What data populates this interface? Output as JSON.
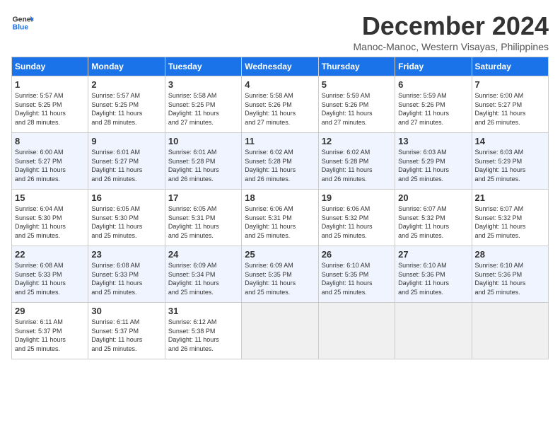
{
  "header": {
    "logo_line1": "General",
    "logo_line2": "Blue",
    "month_year": "December 2024",
    "location": "Manoc-Manoc, Western Visayas, Philippines"
  },
  "weekdays": [
    "Sunday",
    "Monday",
    "Tuesday",
    "Wednesday",
    "Thursday",
    "Friday",
    "Saturday"
  ],
  "weeks": [
    [
      {
        "day": "1",
        "info": "Sunrise: 5:57 AM\nSunset: 5:25 PM\nDaylight: 11 hours\nand 28 minutes."
      },
      {
        "day": "2",
        "info": "Sunrise: 5:57 AM\nSunset: 5:25 PM\nDaylight: 11 hours\nand 28 minutes."
      },
      {
        "day": "3",
        "info": "Sunrise: 5:58 AM\nSunset: 5:25 PM\nDaylight: 11 hours\nand 27 minutes."
      },
      {
        "day": "4",
        "info": "Sunrise: 5:58 AM\nSunset: 5:26 PM\nDaylight: 11 hours\nand 27 minutes."
      },
      {
        "day": "5",
        "info": "Sunrise: 5:59 AM\nSunset: 5:26 PM\nDaylight: 11 hours\nand 27 minutes."
      },
      {
        "day": "6",
        "info": "Sunrise: 5:59 AM\nSunset: 5:26 PM\nDaylight: 11 hours\nand 27 minutes."
      },
      {
        "day": "7",
        "info": "Sunrise: 6:00 AM\nSunset: 5:27 PM\nDaylight: 11 hours\nand 26 minutes."
      }
    ],
    [
      {
        "day": "8",
        "info": "Sunrise: 6:00 AM\nSunset: 5:27 PM\nDaylight: 11 hours\nand 26 minutes."
      },
      {
        "day": "9",
        "info": "Sunrise: 6:01 AM\nSunset: 5:27 PM\nDaylight: 11 hours\nand 26 minutes."
      },
      {
        "day": "10",
        "info": "Sunrise: 6:01 AM\nSunset: 5:28 PM\nDaylight: 11 hours\nand 26 minutes."
      },
      {
        "day": "11",
        "info": "Sunrise: 6:02 AM\nSunset: 5:28 PM\nDaylight: 11 hours\nand 26 minutes."
      },
      {
        "day": "12",
        "info": "Sunrise: 6:02 AM\nSunset: 5:28 PM\nDaylight: 11 hours\nand 26 minutes."
      },
      {
        "day": "13",
        "info": "Sunrise: 6:03 AM\nSunset: 5:29 PM\nDaylight: 11 hours\nand 25 minutes."
      },
      {
        "day": "14",
        "info": "Sunrise: 6:03 AM\nSunset: 5:29 PM\nDaylight: 11 hours\nand 25 minutes."
      }
    ],
    [
      {
        "day": "15",
        "info": "Sunrise: 6:04 AM\nSunset: 5:30 PM\nDaylight: 11 hours\nand 25 minutes."
      },
      {
        "day": "16",
        "info": "Sunrise: 6:05 AM\nSunset: 5:30 PM\nDaylight: 11 hours\nand 25 minutes."
      },
      {
        "day": "17",
        "info": "Sunrise: 6:05 AM\nSunset: 5:31 PM\nDaylight: 11 hours\nand 25 minutes."
      },
      {
        "day": "18",
        "info": "Sunrise: 6:06 AM\nSunset: 5:31 PM\nDaylight: 11 hours\nand 25 minutes."
      },
      {
        "day": "19",
        "info": "Sunrise: 6:06 AM\nSunset: 5:32 PM\nDaylight: 11 hours\nand 25 minutes."
      },
      {
        "day": "20",
        "info": "Sunrise: 6:07 AM\nSunset: 5:32 PM\nDaylight: 11 hours\nand 25 minutes."
      },
      {
        "day": "21",
        "info": "Sunrise: 6:07 AM\nSunset: 5:32 PM\nDaylight: 11 hours\nand 25 minutes."
      }
    ],
    [
      {
        "day": "22",
        "info": "Sunrise: 6:08 AM\nSunset: 5:33 PM\nDaylight: 11 hours\nand 25 minutes."
      },
      {
        "day": "23",
        "info": "Sunrise: 6:08 AM\nSunset: 5:33 PM\nDaylight: 11 hours\nand 25 minutes."
      },
      {
        "day": "24",
        "info": "Sunrise: 6:09 AM\nSunset: 5:34 PM\nDaylight: 11 hours\nand 25 minutes."
      },
      {
        "day": "25",
        "info": "Sunrise: 6:09 AM\nSunset: 5:35 PM\nDaylight: 11 hours\nand 25 minutes."
      },
      {
        "day": "26",
        "info": "Sunrise: 6:10 AM\nSunset: 5:35 PM\nDaylight: 11 hours\nand 25 minutes."
      },
      {
        "day": "27",
        "info": "Sunrise: 6:10 AM\nSunset: 5:36 PM\nDaylight: 11 hours\nand 25 minutes."
      },
      {
        "day": "28",
        "info": "Sunrise: 6:10 AM\nSunset: 5:36 PM\nDaylight: 11 hours\nand 25 minutes."
      }
    ],
    [
      {
        "day": "29",
        "info": "Sunrise: 6:11 AM\nSunset: 5:37 PM\nDaylight: 11 hours\nand 25 minutes."
      },
      {
        "day": "30",
        "info": "Sunrise: 6:11 AM\nSunset: 5:37 PM\nDaylight: 11 hours\nand 25 minutes."
      },
      {
        "day": "31",
        "info": "Sunrise: 6:12 AM\nSunset: 5:38 PM\nDaylight: 11 hours\nand 26 minutes."
      },
      {
        "day": "",
        "info": ""
      },
      {
        "day": "",
        "info": ""
      },
      {
        "day": "",
        "info": ""
      },
      {
        "day": "",
        "info": ""
      }
    ]
  ]
}
